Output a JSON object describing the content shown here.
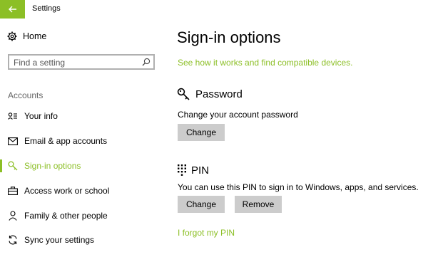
{
  "window": {
    "title": "Settings"
  },
  "colors": {
    "accent": "#8cbf26",
    "button_bg": "#cccccc"
  },
  "sidebar": {
    "home_label": "Home",
    "search_placeholder": "Find a setting",
    "section_label": "Accounts",
    "items": [
      {
        "label": "Your info",
        "icon": "contact-icon"
      },
      {
        "label": "Email & app accounts",
        "icon": "email-icon"
      },
      {
        "label": "Sign-in options",
        "icon": "key-icon",
        "active": true
      },
      {
        "label": "Access work or school",
        "icon": "briefcase-icon"
      },
      {
        "label": "Family & other people",
        "icon": "person-icon"
      },
      {
        "label": "Sync your settings",
        "icon": "sync-icon"
      }
    ]
  },
  "main": {
    "title": "Sign-in options",
    "devices_link": "See how it works and find compatible devices.",
    "password": {
      "header": "Password",
      "description": "Change your account password",
      "change_label": "Change"
    },
    "pin": {
      "header": "PIN",
      "description": "You can use this PIN to sign in to Windows, apps, and services.",
      "change_label": "Change",
      "remove_label": "Remove",
      "forgot_link": "I forgot my PIN"
    }
  }
}
